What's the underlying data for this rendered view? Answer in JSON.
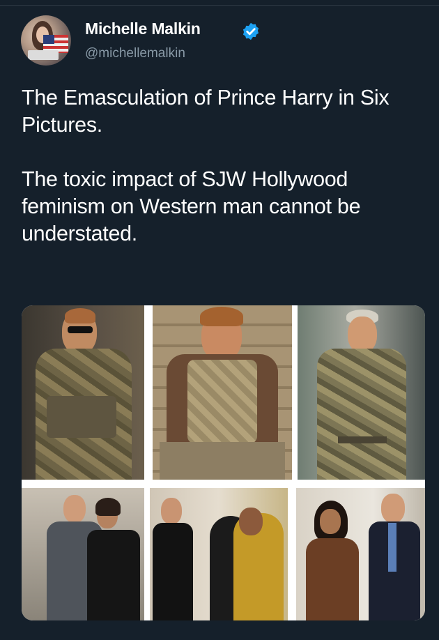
{
  "author": {
    "display_name": "Michelle Malkin",
    "handle": "@michellemalkin",
    "verified": true,
    "avatar_icon": "profile-photo-avatar"
  },
  "tweet": {
    "paragraphs": [
      "The Emasculation of Prince Harry in Six Pictures.",
      "The toxic impact of SJW Hollywood feminism on Western man cannot be understated."
    ]
  },
  "media": {
    "photo_count": 6,
    "photos": [
      {
        "subject": "man in camouflage uniform with sunglasses"
      },
      {
        "subject": "smiling man in tactical vest seated by sandbags"
      },
      {
        "subject": "man in beret and camouflage uniform"
      },
      {
        "subject": "man in suit beside woman in black dress"
      },
      {
        "subject": "man in tuxedo, women embracing"
      },
      {
        "subject": "woman in brown outfit beside man in suit"
      }
    ]
  },
  "colors": {
    "background": "#15202b",
    "text_primary": "#ffffff",
    "text_secondary": "#8899a6",
    "verified_badge": "#1da1f2"
  }
}
